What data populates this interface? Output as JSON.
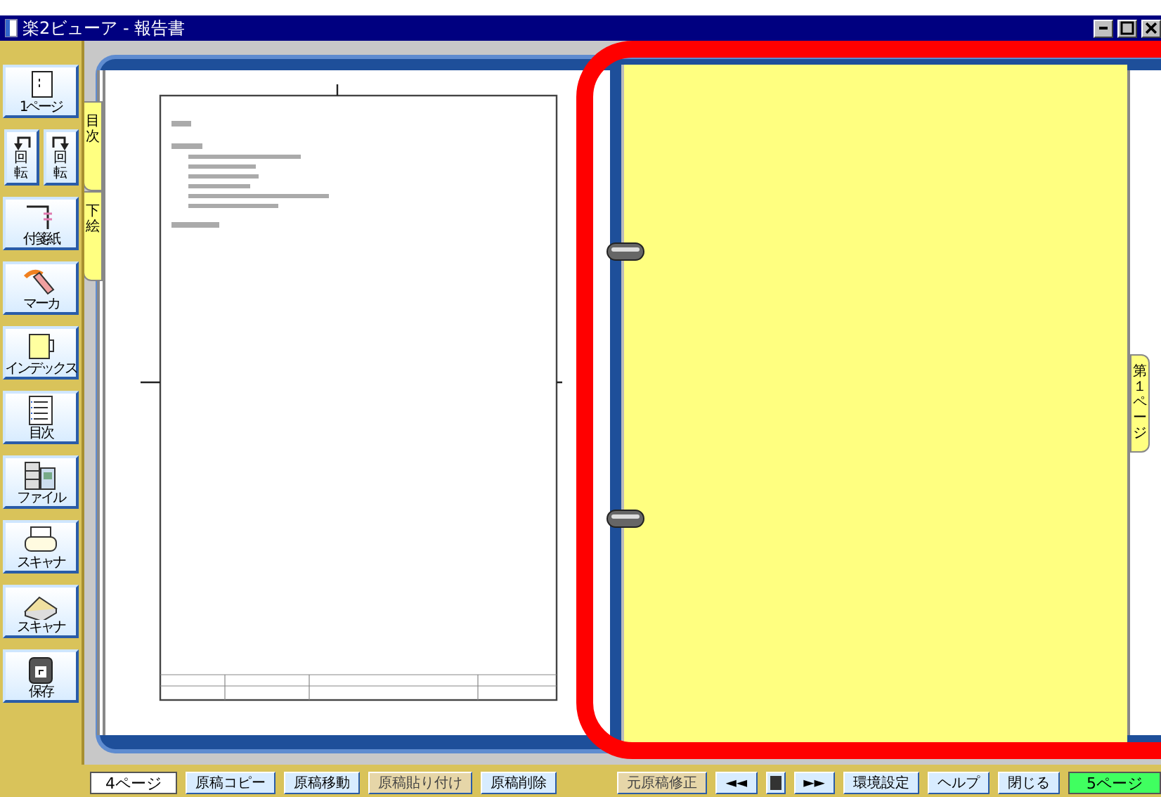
{
  "window": {
    "title": "楽2ビューア - 報告書"
  },
  "tools": [
    {
      "kind": "page",
      "labels": [
        "1ページ"
      ]
    },
    {
      "kind": "rotate",
      "labels": [
        "回転",
        "回転"
      ]
    },
    {
      "kind": "sticky",
      "labels": [
        "付箋紙"
      ]
    },
    {
      "kind": "marker",
      "labels": [
        "マーカ"
      ]
    },
    {
      "kind": "index",
      "labels": [
        "インデックス"
      ]
    },
    {
      "kind": "toc",
      "labels": [
        "目次"
      ]
    },
    {
      "kind": "file",
      "labels": [
        "ファイル"
      ]
    },
    {
      "kind": "printer",
      "labels": [
        "スキャナ"
      ]
    },
    {
      "kind": "scanner",
      "labels": [
        "スキャナ"
      ]
    },
    {
      "kind": "save",
      "labels": [
        "保存"
      ]
    }
  ],
  "left_tabs": [
    {
      "label": "目次"
    },
    {
      "label": "下絵"
    }
  ],
  "right_tabs": [
    {
      "label": "第１ページ"
    }
  ],
  "annotation": {
    "kind": "highlight",
    "color": "#ff0000"
  },
  "footer": {
    "left_page": "4ページ",
    "buttons": [
      {
        "kind": "text",
        "label": "原稿コピー",
        "disabled": false
      },
      {
        "kind": "text",
        "label": "原稿移動",
        "disabled": false
      },
      {
        "kind": "text",
        "label": "原稿貼り付け",
        "disabled": true
      },
      {
        "kind": "text",
        "label": "原稿削除",
        "disabled": false
      },
      {
        "kind": "gap"
      },
      {
        "kind": "text",
        "label": "元原稿修正",
        "disabled": true
      },
      {
        "kind": "text",
        "label": "◄◄",
        "disabled": false
      },
      {
        "kind": "stop",
        "disabled": false
      },
      {
        "kind": "text",
        "label": "►►",
        "disabled": false
      },
      {
        "kind": "text",
        "label": "環境設定",
        "disabled": false
      },
      {
        "kind": "text",
        "label": "ヘルプ",
        "disabled": false
      },
      {
        "kind": "text",
        "label": "閉じる",
        "disabled": false
      }
    ],
    "right_page": "5ページ"
  }
}
